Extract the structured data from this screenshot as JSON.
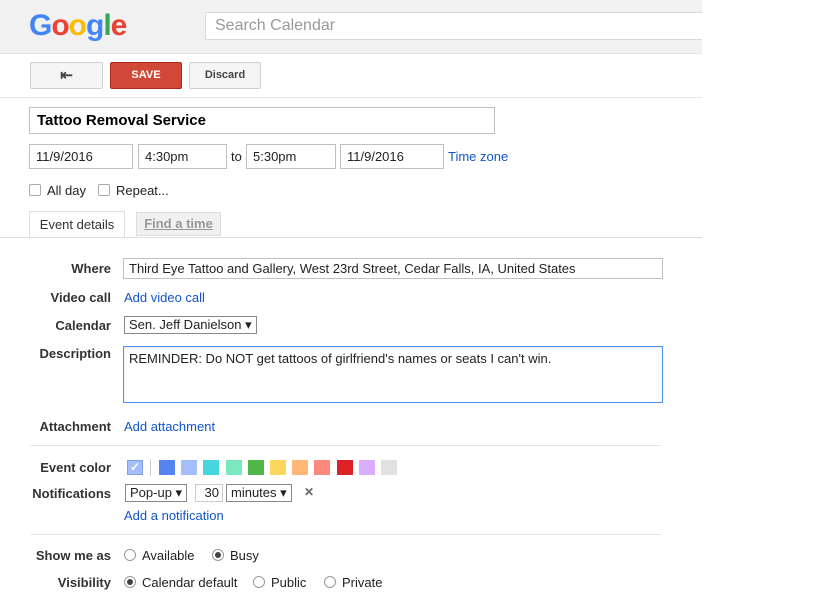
{
  "header": {
    "logo_letters": [
      "G",
      "o",
      "o",
      "g",
      "l",
      "e"
    ],
    "search_placeholder": "Search Calendar"
  },
  "toolbar": {
    "back_icon": "⇤",
    "save_label": "SAVE",
    "discard_label": "Discard"
  },
  "event": {
    "title": "Tattoo Removal Service",
    "start_date": "11/9/2016",
    "start_time": "4:30pm",
    "to_label": "to",
    "end_time": "5:30pm",
    "end_date": "11/9/2016",
    "time_zone_link": "Time zone",
    "all_day_label": "All day",
    "repeat_label": "Repeat..."
  },
  "tabs": {
    "event_details": "Event details",
    "find_a_time": "Find a time"
  },
  "details": {
    "where_label": "Where",
    "where_value": "Third Eye Tattoo and Gallery, West 23rd Street, Cedar Falls, IA, United States",
    "video_call_label": "Video call",
    "video_call_link": "Add video call",
    "calendar_label": "Calendar",
    "calendar_value": "Sen. Jeff Danielson ▾",
    "description_label": "Description",
    "description_value": "REMINDER: Do NOT get tattoos of girlfriend's names or seats I can't win.",
    "attachment_label": "Attachment",
    "attachment_link": "Add attachment",
    "event_color_label": "Event color",
    "color_swatches": [
      "#a4bdfc",
      "#5484ed",
      "#a4bdfc",
      "#46d6db",
      "#7ae7bf",
      "#51b749",
      "#fbd75b",
      "#ffb878",
      "#ff887c",
      "#dc2127",
      "#dbadff",
      "#e1e1e1"
    ],
    "selected_color_check": "✓",
    "notifications_label": "Notifications",
    "notification_type": "Pop-up ▾",
    "notification_value": "30",
    "notification_unit": "minutes ▾",
    "remove_notification_icon": "✕",
    "add_notification_link": "Add a notification",
    "show_me_as_label": "Show me as",
    "available_label": "Available",
    "busy_label": "Busy",
    "visibility_label": "Visibility",
    "calendar_default_label": "Calendar default",
    "public_label": "Public",
    "private_label": "Private"
  }
}
